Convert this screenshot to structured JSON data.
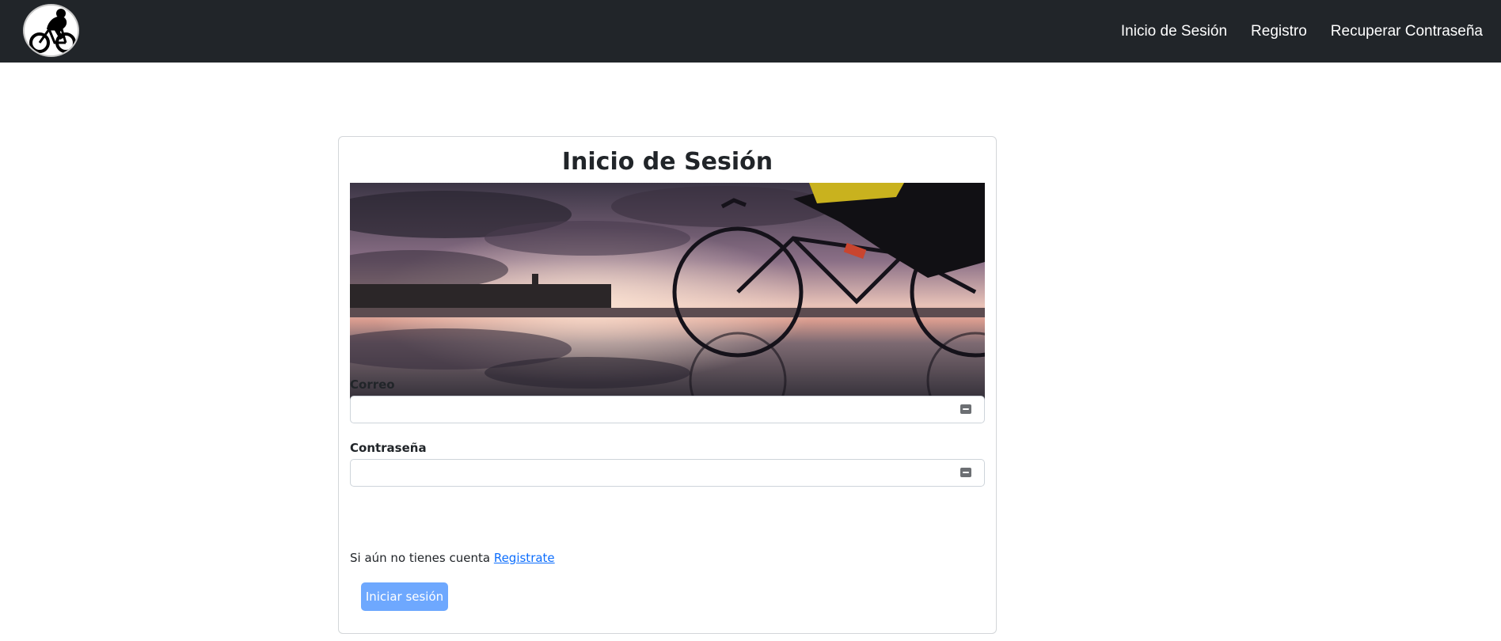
{
  "navbar": {
    "logo_icon": "cyclist-logo-icon",
    "links": [
      {
        "label": "Inicio de Sesión"
      },
      {
        "label": "Registro"
      },
      {
        "label": "Recuperar Contraseña"
      }
    ]
  },
  "login": {
    "title": "Inicio de Sesión",
    "hero_image": "cyclist-sunset-reflection-photo",
    "email": {
      "label": "Correo",
      "value": "",
      "placeholder": "",
      "icon": "password-manager-icon"
    },
    "password": {
      "label": "Contraseña",
      "value": "",
      "placeholder": "",
      "icon": "password-manager-icon"
    },
    "register_prompt": "Si aún no tienes cuenta",
    "register_link": "Registrate",
    "submit_label": "Iniciar sesión"
  },
  "colors": {
    "navbar_bg": "#212529",
    "link": "#0d6efd",
    "button_bg": "#6ea8fe"
  }
}
